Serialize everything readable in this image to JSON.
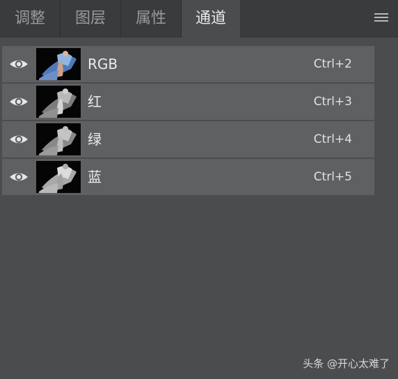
{
  "tabs": [
    {
      "label": "调整",
      "active": false
    },
    {
      "label": "图层",
      "active": false
    },
    {
      "label": "属性",
      "active": false
    },
    {
      "label": "通道",
      "active": true
    }
  ],
  "menu_icon": "hamburger-menu-icon",
  "channels": [
    {
      "label": "RGB",
      "shortcut": "Ctrl+2",
      "visible": true,
      "thumbnail": "color"
    },
    {
      "label": "红",
      "shortcut": "Ctrl+3",
      "visible": true,
      "thumbnail": "grayscale"
    },
    {
      "label": "绿",
      "shortcut": "Ctrl+4",
      "visible": true,
      "thumbnail": "grayscale"
    },
    {
      "label": "蓝",
      "shortcut": "Ctrl+5",
      "visible": true,
      "thumbnail": "grayscale"
    }
  ],
  "watermark": "头条 @开心太难了",
  "colors": {
    "panel_bg": "#4b4c4e",
    "tabbar_bg": "#3a3b3d",
    "row_bg": "#5f6062"
  }
}
